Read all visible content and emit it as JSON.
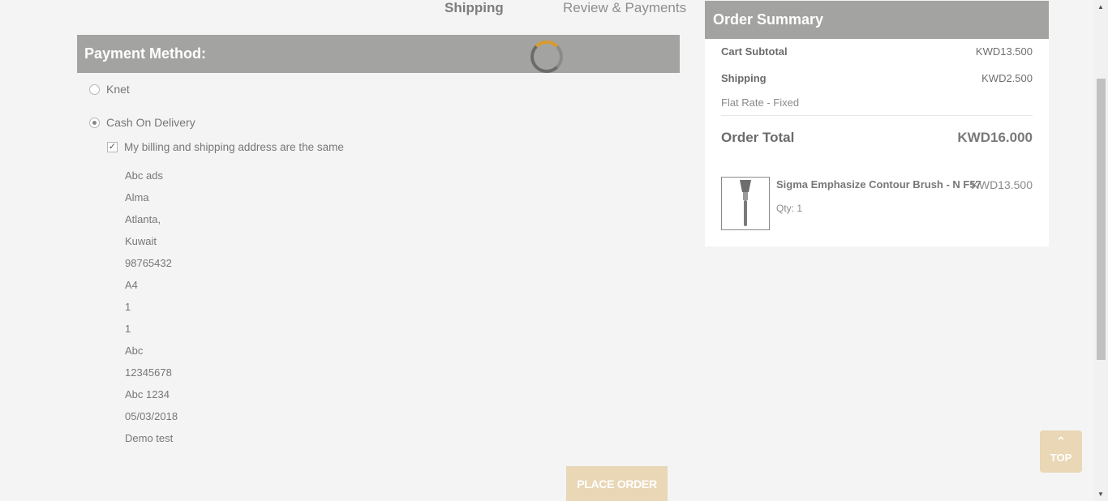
{
  "steps": {
    "shipping": "Shipping",
    "review": "Review & Payments"
  },
  "payment": {
    "title": "Payment Method:",
    "methods": [
      {
        "label": "Knet",
        "checked": false
      },
      {
        "label": "Cash On Delivery",
        "checked": true
      }
    ],
    "same_address_label": "My billing and shipping address are the same",
    "address_lines": [
      "Abc ads",
      "Alma",
      "Atlanta,",
      "Kuwait",
      "98765432",
      "A4",
      "1",
      "1",
      "Abc",
      "12345678",
      "Abc 1234",
      "05/03/2018",
      "Demo test"
    ],
    "place_order_label": "PLACE ORDER"
  },
  "summary": {
    "title": "Order Summary",
    "subtotal_label": "Cart Subtotal",
    "subtotal_value": "KWD13.500",
    "shipping_label": "Shipping",
    "shipping_value": "KWD2.500",
    "shipping_method": "Flat Rate - Fixed",
    "total_label": "Order Total",
    "total_value": "KWD16.000",
    "items": [
      {
        "name": "Sigma Emphasize Contour Brush - N F57",
        "price": "KWD13.500",
        "qty": "Qty: 1"
      }
    ]
  },
  "top_button": {
    "icon": "chevron-up-icon",
    "label": "TOP"
  },
  "colors": {
    "header_bg": "#a3a3a1",
    "accent": "#e9d7b5",
    "spinner_accent": "#d79b2e"
  }
}
